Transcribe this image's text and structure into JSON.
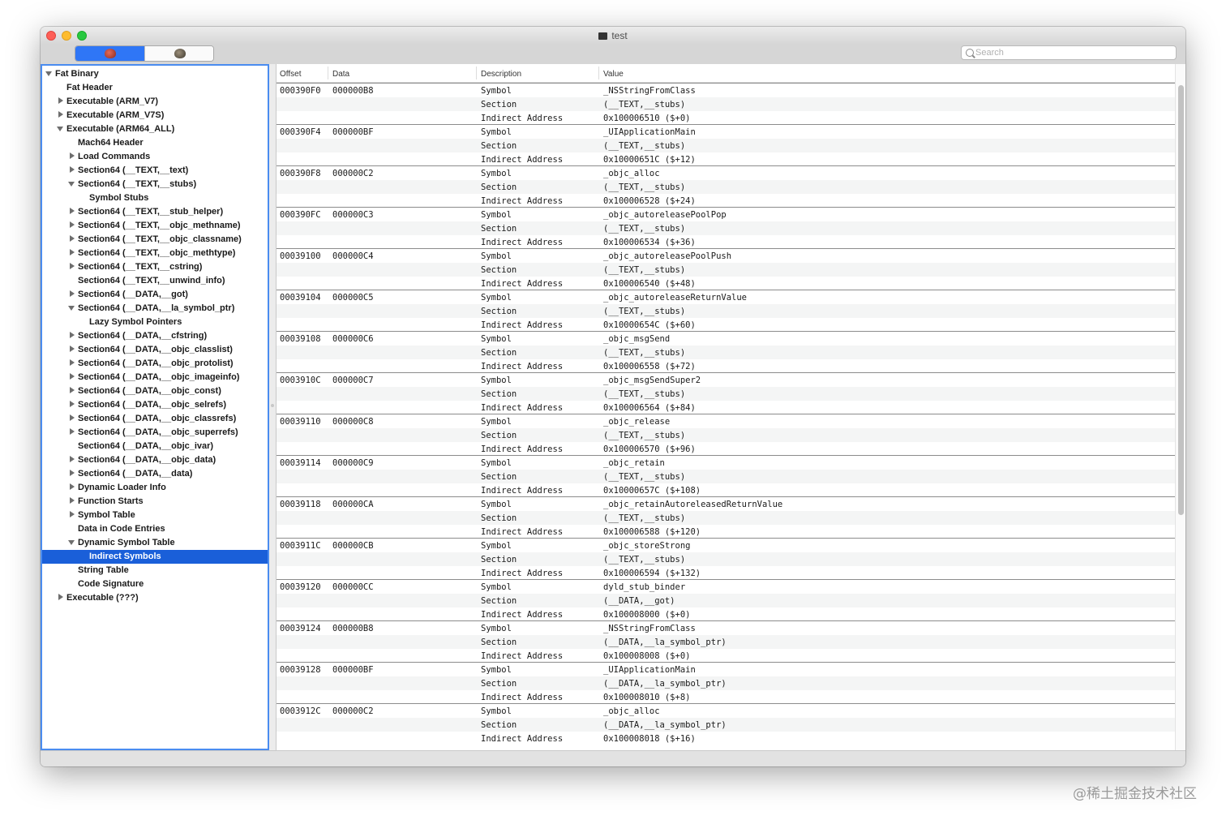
{
  "window": {
    "title": "test"
  },
  "toolbar": {
    "segment_left_icon": "bug-red-icon",
    "segment_right_icon": "bug-gray-icon"
  },
  "search": {
    "placeholder": "Search",
    "value": ""
  },
  "tree": [
    {
      "label": "Fat Binary",
      "level": 0,
      "toggle": "open"
    },
    {
      "label": "Fat Header",
      "level": 1,
      "toggle": "none"
    },
    {
      "label": "Executable  (ARM_V7)",
      "level": 1,
      "toggle": "closed"
    },
    {
      "label": "Executable  (ARM_V7S)",
      "level": 1,
      "toggle": "closed"
    },
    {
      "label": "Executable  (ARM64_ALL)",
      "level": 1,
      "toggle": "open"
    },
    {
      "label": "Mach64 Header",
      "level": 2,
      "toggle": "none"
    },
    {
      "label": "Load Commands",
      "level": 2,
      "toggle": "closed"
    },
    {
      "label": "Section64 (__TEXT,__text)",
      "level": 2,
      "toggle": "closed"
    },
    {
      "label": "Section64 (__TEXT,__stubs)",
      "level": 2,
      "toggle": "open"
    },
    {
      "label": "Symbol Stubs",
      "level": 3,
      "toggle": "none"
    },
    {
      "label": "Section64 (__TEXT,__stub_helper)",
      "level": 2,
      "toggle": "closed"
    },
    {
      "label": "Section64 (__TEXT,__objc_methname)",
      "level": 2,
      "toggle": "closed"
    },
    {
      "label": "Section64 (__TEXT,__objc_classname)",
      "level": 2,
      "toggle": "closed"
    },
    {
      "label": "Section64 (__TEXT,__objc_methtype)",
      "level": 2,
      "toggle": "closed"
    },
    {
      "label": "Section64 (__TEXT,__cstring)",
      "level": 2,
      "toggle": "closed"
    },
    {
      "label": "Section64 (__TEXT,__unwind_info)",
      "level": 2,
      "toggle": "none"
    },
    {
      "label": "Section64 (__DATA,__got)",
      "level": 2,
      "toggle": "closed"
    },
    {
      "label": "Section64 (__DATA,__la_symbol_ptr)",
      "level": 2,
      "toggle": "open"
    },
    {
      "label": "Lazy Symbol Pointers",
      "level": 3,
      "toggle": "none"
    },
    {
      "label": "Section64 (__DATA,__cfstring)",
      "level": 2,
      "toggle": "closed"
    },
    {
      "label": "Section64 (__DATA,__objc_classlist)",
      "level": 2,
      "toggle": "closed"
    },
    {
      "label": "Section64 (__DATA,__objc_protolist)",
      "level": 2,
      "toggle": "closed"
    },
    {
      "label": "Section64 (__DATA,__objc_imageinfo)",
      "level": 2,
      "toggle": "closed"
    },
    {
      "label": "Section64 (__DATA,__objc_const)",
      "level": 2,
      "toggle": "closed"
    },
    {
      "label": "Section64 (__DATA,__objc_selrefs)",
      "level": 2,
      "toggle": "closed"
    },
    {
      "label": "Section64 (__DATA,__objc_classrefs)",
      "level": 2,
      "toggle": "closed"
    },
    {
      "label": "Section64 (__DATA,__objc_superrefs)",
      "level": 2,
      "toggle": "closed"
    },
    {
      "label": "Section64 (__DATA,__objc_ivar)",
      "level": 2,
      "toggle": "none"
    },
    {
      "label": "Section64 (__DATA,__objc_data)",
      "level": 2,
      "toggle": "closed"
    },
    {
      "label": "Section64 (__DATA,__data)",
      "level": 2,
      "toggle": "closed"
    },
    {
      "label": "Dynamic Loader Info",
      "level": 2,
      "toggle": "closed"
    },
    {
      "label": "Function Starts",
      "level": 2,
      "toggle": "closed"
    },
    {
      "label": "Symbol Table",
      "level": 2,
      "toggle": "closed"
    },
    {
      "label": "Data in Code Entries",
      "level": 2,
      "toggle": "none"
    },
    {
      "label": "Dynamic Symbol Table",
      "level": 2,
      "toggle": "open"
    },
    {
      "label": "Indirect Symbols",
      "level": 3,
      "toggle": "none",
      "selected": true
    },
    {
      "label": "String Table",
      "level": 2,
      "toggle": "none"
    },
    {
      "label": "Code Signature",
      "level": 2,
      "toggle": "none"
    },
    {
      "label": "Executable  (???)",
      "level": 1,
      "toggle": "closed"
    }
  ],
  "table": {
    "columns": {
      "offset": "Offset",
      "data": "Data",
      "description": "Description",
      "value": "Value"
    },
    "groups": [
      {
        "offset": "000390F0",
        "data": "000000B8",
        "lines": [
          [
            "Symbol",
            "_NSStringFromClass"
          ],
          [
            "Section",
            "(__TEXT,__stubs)"
          ],
          [
            "Indirect Address",
            "0x100006510 ($+0)"
          ]
        ]
      },
      {
        "offset": "000390F4",
        "data": "000000BF",
        "lines": [
          [
            "Symbol",
            "_UIApplicationMain"
          ],
          [
            "Section",
            "(__TEXT,__stubs)"
          ],
          [
            "Indirect Address",
            "0x10000651C ($+12)"
          ]
        ]
      },
      {
        "offset": "000390F8",
        "data": "000000C2",
        "lines": [
          [
            "Symbol",
            "_objc_alloc"
          ],
          [
            "Section",
            "(__TEXT,__stubs)"
          ],
          [
            "Indirect Address",
            "0x100006528 ($+24)"
          ]
        ]
      },
      {
        "offset": "000390FC",
        "data": "000000C3",
        "lines": [
          [
            "Symbol",
            "_objc_autoreleasePoolPop"
          ],
          [
            "Section",
            "(__TEXT,__stubs)"
          ],
          [
            "Indirect Address",
            "0x100006534 ($+36)"
          ]
        ]
      },
      {
        "offset": "00039100",
        "data": "000000C4",
        "lines": [
          [
            "Symbol",
            "_objc_autoreleasePoolPush"
          ],
          [
            "Section",
            "(__TEXT,__stubs)"
          ],
          [
            "Indirect Address",
            "0x100006540 ($+48)"
          ]
        ]
      },
      {
        "offset": "00039104",
        "data": "000000C5",
        "lines": [
          [
            "Symbol",
            "_objc_autoreleaseReturnValue"
          ],
          [
            "Section",
            "(__TEXT,__stubs)"
          ],
          [
            "Indirect Address",
            "0x10000654C ($+60)"
          ]
        ]
      },
      {
        "offset": "00039108",
        "data": "000000C6",
        "lines": [
          [
            "Symbol",
            "_objc_msgSend"
          ],
          [
            "Section",
            "(__TEXT,__stubs)"
          ],
          [
            "Indirect Address",
            "0x100006558 ($+72)"
          ]
        ]
      },
      {
        "offset": "0003910C",
        "data": "000000C7",
        "lines": [
          [
            "Symbol",
            "_objc_msgSendSuper2"
          ],
          [
            "Section",
            "(__TEXT,__stubs)"
          ],
          [
            "Indirect Address",
            "0x100006564 ($+84)"
          ]
        ]
      },
      {
        "offset": "00039110",
        "data": "000000C8",
        "lines": [
          [
            "Symbol",
            "_objc_release"
          ],
          [
            "Section",
            "(__TEXT,__stubs)"
          ],
          [
            "Indirect Address",
            "0x100006570 ($+96)"
          ]
        ]
      },
      {
        "offset": "00039114",
        "data": "000000C9",
        "lines": [
          [
            "Symbol",
            "_objc_retain"
          ],
          [
            "Section",
            "(__TEXT,__stubs)"
          ],
          [
            "Indirect Address",
            "0x10000657C ($+108)"
          ]
        ]
      },
      {
        "offset": "00039118",
        "data": "000000CA",
        "lines": [
          [
            "Symbol",
            "_objc_retainAutoreleasedReturnValue"
          ],
          [
            "Section",
            "(__TEXT,__stubs)"
          ],
          [
            "Indirect Address",
            "0x100006588 ($+120)"
          ]
        ]
      },
      {
        "offset": "0003911C",
        "data": "000000CB",
        "lines": [
          [
            "Symbol",
            "_objc_storeStrong"
          ],
          [
            "Section",
            "(__TEXT,__stubs)"
          ],
          [
            "Indirect Address",
            "0x100006594 ($+132)"
          ]
        ]
      },
      {
        "offset": "00039120",
        "data": "000000CC",
        "lines": [
          [
            "Symbol",
            "dyld_stub_binder"
          ],
          [
            "Section",
            "(__DATA,__got)"
          ],
          [
            "Indirect Address",
            "0x100008000 ($+0)"
          ]
        ]
      },
      {
        "offset": "00039124",
        "data": "000000B8",
        "lines": [
          [
            "Symbol",
            "_NSStringFromClass"
          ],
          [
            "Section",
            "(__DATA,__la_symbol_ptr)"
          ],
          [
            "Indirect Address",
            "0x100008008 ($+0)"
          ]
        ]
      },
      {
        "offset": "00039128",
        "data": "000000BF",
        "lines": [
          [
            "Symbol",
            "_UIApplicationMain"
          ],
          [
            "Section",
            "(__DATA,__la_symbol_ptr)"
          ],
          [
            "Indirect Address",
            "0x100008010 ($+8)"
          ]
        ]
      },
      {
        "offset": "0003912C",
        "data": "000000C2",
        "lines": [
          [
            "Symbol",
            "_objc_alloc"
          ],
          [
            "Section",
            "(__DATA,__la_symbol_ptr)"
          ],
          [
            "Indirect Address",
            "0x100008018 ($+16)"
          ]
        ]
      }
    ]
  },
  "watermark": "@稀土掘金技术社区"
}
